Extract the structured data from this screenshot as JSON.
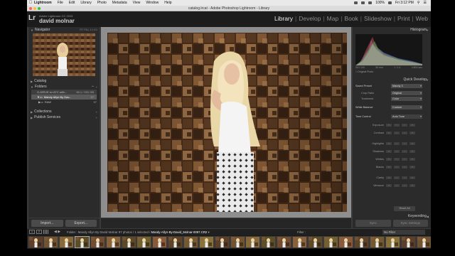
{
  "menubar": {
    "items": [
      "Lightroom",
      "File",
      "Edit",
      "Library",
      "Photo",
      "Metadata",
      "View",
      "Window",
      "Help"
    ],
    "battery": "100%",
    "clock": "Fri 3:12 PM"
  },
  "window": {
    "title": "catalog.lrcat - Adobe Photoshop Lightroom - Library"
  },
  "identity": {
    "version": "Adobe Lightroom CC 2015",
    "user": "david molnar"
  },
  "modules": [
    "Library",
    "Develop",
    "Map",
    "Book",
    "Slideshow",
    "Print",
    "Web"
  ],
  "left_panel": {
    "navigator": {
      "title": "Navigator",
      "zoom": "FIT  FILL  1:1  4:1"
    },
    "catalog": {
      "title": "Catalog"
    },
    "folders": {
      "title": "Folders"
    },
    "drive": {
      "name": "G-DRIVE ev ATC with...",
      "size": "90.1 / 931 GB"
    },
    "folder_selected": {
      "name": "Mandy Allyn By Dav...",
      "count": "97"
    },
    "subfolder": {
      "name": "RAW",
      "count": "97"
    },
    "collections": {
      "title": "Collections"
    },
    "publish": {
      "title": "Publish Services"
    },
    "import_label": "Import...",
    "export_label": "Export..."
  },
  "right_panel": {
    "histogram": {
      "title": "Histogram",
      "iso": "ISO 100",
      "focal": "50 mm",
      "aperture": "f / 1.4",
      "shutter": "1/500 sec",
      "original_photo": "Original Photo"
    },
    "quick_develop": {
      "title": "Quick Develop",
      "saved_preset_label": "Saved Preset",
      "saved_preset_value": "Mandy 3",
      "crop_ratio_label": "Crop Ratio",
      "crop_ratio_value": "Original",
      "treatment_label": "Treatment",
      "treatment_value": "Color",
      "white_balance_label": "White Balance",
      "white_balance_value": "Custom",
      "tone_control_label": "Tone Control",
      "auto_tone_label": "Auto Tone",
      "tone_rows": [
        "Exposure",
        "Contrast",
        "Highlights",
        "Shadows",
        "Whites",
        "Blacks",
        "Clarity",
        "Vibrance"
      ],
      "reset_label": "Reset All"
    },
    "keywording": {
      "title": "Keywording"
    },
    "sync_label": "Sync",
    "sync_settings_label": "Sync Settings"
  },
  "filmstrip_bar": {
    "views": [
      "1",
      "2"
    ],
    "source_prefix": "Folder : Mandy Allyn By David Molnar",
    "source_count": "97 photos / 1 selected /",
    "file_name": "Mandy-Allyn-By-David_Molnar-0097.CR2",
    "filter_label": "Filter :",
    "filter_value": "No Filter"
  },
  "filmstrip": {
    "count": 26,
    "selected_index": 3
  },
  "colors": {
    "panel": "#2b2b2b",
    "active_module": "#f0f0f0",
    "inactive_module": "#8d8d8d",
    "selection": "#a6a6a6"
  }
}
